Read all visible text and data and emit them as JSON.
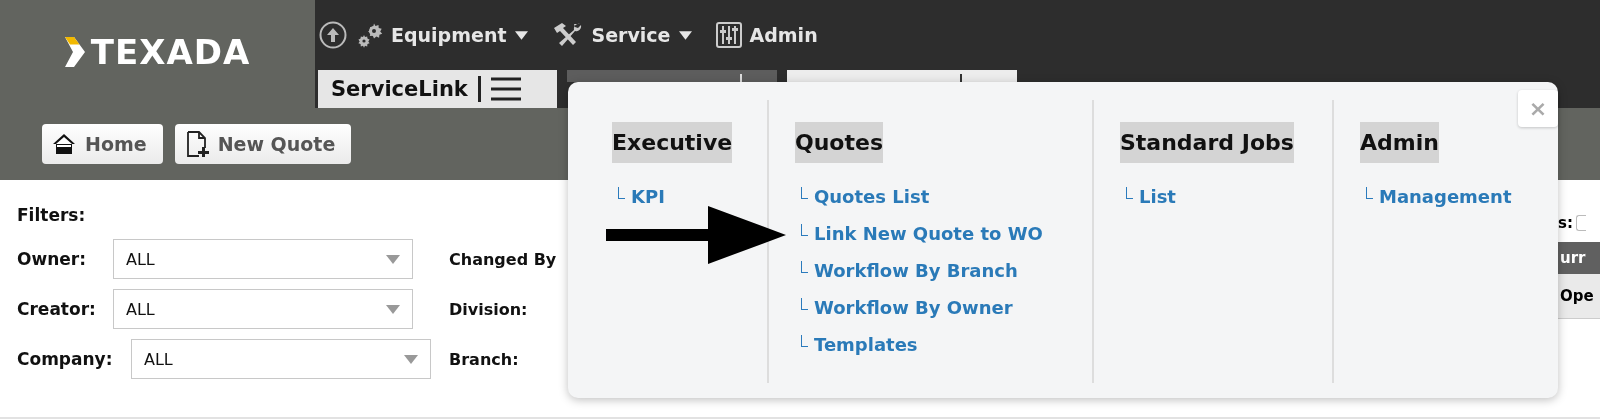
{
  "logo": {
    "text": "TEXADA"
  },
  "nav": [
    {
      "label": "Equipment",
      "dropdown": true
    },
    {
      "label": "Service",
      "dropdown": true
    },
    {
      "label": "Admin",
      "dropdown": false
    }
  ],
  "app_tab": {
    "label": "ServiceLink"
  },
  "toolbar": {
    "buttons": [
      {
        "label": "Home"
      },
      {
        "label": "New Quote"
      }
    ]
  },
  "filters": {
    "title": "Filters:",
    "fields": [
      {
        "label": "Owner:",
        "value": "ALL"
      },
      {
        "label": "Creator:",
        "value": "ALL"
      },
      {
        "label": "Company:",
        "value": "ALL"
      }
    ],
    "right_labels": [
      "Changed By",
      "Division:",
      "Branch:"
    ]
  },
  "behind": {
    "label": "s:",
    "checked": false,
    "header": "urr",
    "cell": "Ope"
  },
  "menu": {
    "close": "×",
    "columns": [
      {
        "heading": "Executive",
        "links": [
          "KPI"
        ]
      },
      {
        "heading": "Quotes",
        "links": [
          "Quotes List",
          "Link New Quote to WO",
          "Workflow By Branch",
          "Workflow By Owner",
          "Templates"
        ]
      },
      {
        "heading": "Standard Jobs",
        "links": [
          "List"
        ]
      },
      {
        "heading": "Admin",
        "links": [
          "Management"
        ]
      }
    ]
  }
}
